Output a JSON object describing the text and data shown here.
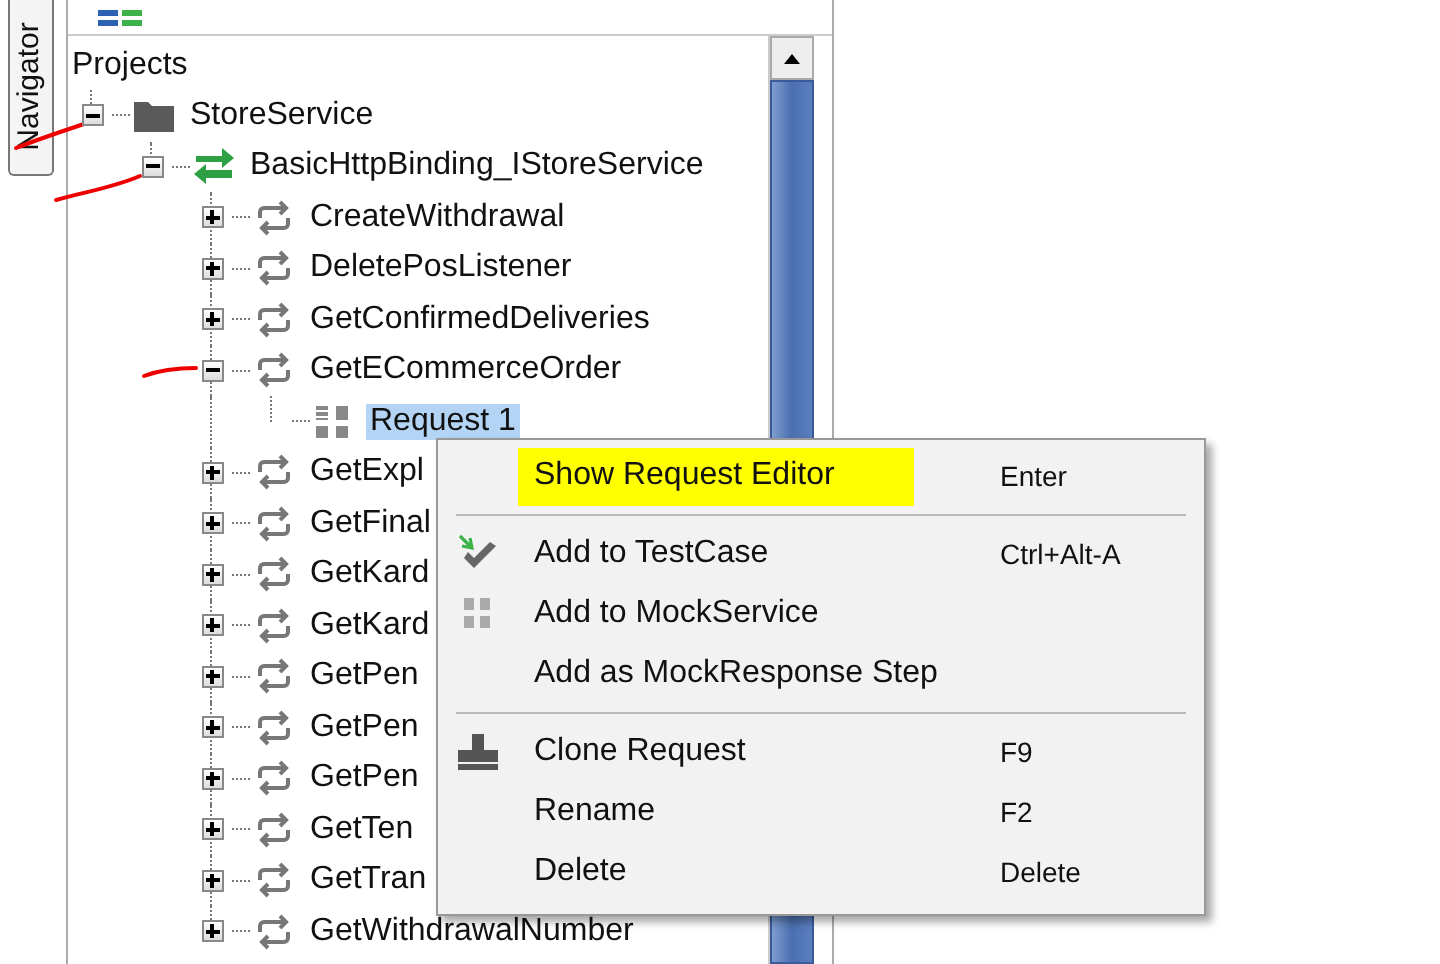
{
  "side_tab": {
    "label": "Navigator"
  },
  "tree": {
    "title": "Projects",
    "items": [
      {
        "label": "StoreService",
        "kind": "project",
        "expanded": true,
        "selected": false,
        "children": [
          {
            "label": "BasicHttpBinding_IStoreService",
            "kind": "interface",
            "expanded": true,
            "selected": false,
            "children": [
              {
                "label": "CreateWithdrawal",
                "kind": "operation",
                "expanded": false,
                "selected": false
              },
              {
                "label": "DeletePosListener",
                "kind": "operation",
                "expanded": false,
                "selected": false
              },
              {
                "label": "GetConfirmedDeliveries",
                "kind": "operation",
                "expanded": false,
                "selected": false
              },
              {
                "label": "GetECommerceOrder",
                "kind": "operation",
                "expanded": true,
                "selected": false,
                "children": [
                  {
                    "label": "Request 1",
                    "kind": "request",
                    "selected": true
                  }
                ]
              },
              {
                "label": "GetExpl",
                "kind": "operation",
                "expanded": false,
                "selected": false
              },
              {
                "label": "GetFinal",
                "kind": "operation",
                "expanded": false,
                "selected": false
              },
              {
                "label": "GetKard",
                "kind": "operation",
                "expanded": false,
                "selected": false
              },
              {
                "label": "GetKard",
                "kind": "operation",
                "expanded": false,
                "selected": false
              },
              {
                "label": "GetPen",
                "kind": "operation",
                "expanded": false,
                "selected": false
              },
              {
                "label": "GetPen",
                "kind": "operation",
                "expanded": false,
                "selected": false
              },
              {
                "label": "GetPen",
                "kind": "operation",
                "expanded": false,
                "selected": false
              },
              {
                "label": "GetTen",
                "kind": "operation",
                "expanded": false,
                "selected": false
              },
              {
                "label": "GetTran",
                "kind": "operation",
                "expanded": false,
                "selected": false
              },
              {
                "label": "GetWithdrawalNumber",
                "kind": "operation",
                "expanded": false,
                "selected": false
              }
            ]
          }
        ]
      }
    ]
  },
  "context_menu": {
    "items": [
      {
        "kind": "item",
        "label": "Show Request Editor",
        "shortcut": "Enter",
        "highlighted": true
      },
      {
        "kind": "separator"
      },
      {
        "kind": "item",
        "label": "Add to TestCase",
        "shortcut": "Ctrl+Alt-A",
        "highlighted": false
      },
      {
        "kind": "item",
        "label": "Add to MockService",
        "highlighted": false
      },
      {
        "kind": "item",
        "label": "Add as MockResponse Step",
        "highlighted": false
      },
      {
        "kind": "separator"
      },
      {
        "kind": "item",
        "label": "Clone Request",
        "shortcut": "F9",
        "highlighted": false
      },
      {
        "kind": "item",
        "label": "Rename",
        "shortcut": "F2",
        "highlighted": false
      },
      {
        "kind": "item",
        "label": "Delete",
        "shortcut": "Delete",
        "highlighted": false
      }
    ]
  }
}
